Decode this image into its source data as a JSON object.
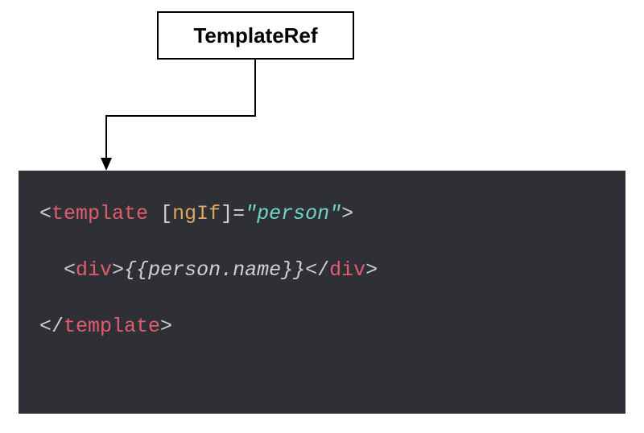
{
  "label": {
    "title": "TemplateRef"
  },
  "code": {
    "line1": {
      "open": "<",
      "tag": "template",
      "space": " ",
      "lbracket": "[",
      "attr": "ngIf",
      "rbracket": "]",
      "eq": "=",
      "val": "\"person\"",
      "close": ">"
    },
    "line2": {
      "indent": "  ",
      "open": "<",
      "tag": "div",
      "close": ">",
      "interp": "{{person.name}}",
      "copen": "</",
      "ctag": "div",
      "cclose": ">"
    },
    "line3": {
      "open": "</",
      "tag": "template",
      "close": ">"
    }
  }
}
